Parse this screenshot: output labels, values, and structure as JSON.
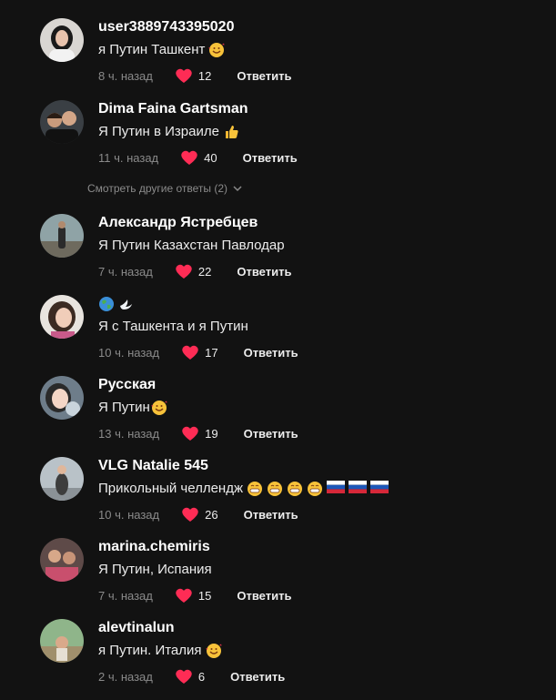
{
  "comments": [
    {
      "username": "user3889743395020",
      "text": "я Путин Ташкент",
      "emoji": [
        "smiling-hearts"
      ],
      "time": "8 ч. назад",
      "likes": "12",
      "reply": "Ответить"
    },
    {
      "username": "Dima Faina Gartsman",
      "text": "Я Путин в Израиле",
      "emoji": [
        "thumbs-up"
      ],
      "time": "11 ч. назад",
      "likes": "40",
      "reply": "Ответить"
    },
    {
      "username": "Александр Ястребцев",
      "text": "Я Путин Казахстан Павлодар",
      "emoji": [],
      "time": "7 ч. назад",
      "likes": "22",
      "reply": "Ответить"
    },
    {
      "username": "",
      "username_emoji": [
        "globe",
        "dove"
      ],
      "text": "Я с Ташкента и я Путин",
      "emoji": [],
      "time": "10 ч. назад",
      "likes": "17",
      "reply": "Ответить"
    },
    {
      "username": "Русская",
      "text": "Я Путин",
      "emoji": [
        "smiling-hearts"
      ],
      "time": "13 ч. назад",
      "likes": "19",
      "reply": "Ответить"
    },
    {
      "username": "VLG Natalie 545",
      "text": "Прикольный челлендж",
      "emoji": [
        "grin",
        "grin",
        "grin",
        "grin",
        "flag-ru",
        "flag-ru",
        "flag-ru"
      ],
      "time": "10 ч. назад",
      "likes": "26",
      "reply": "Ответить"
    },
    {
      "username": "marina.chemiris",
      "text": "Я Путин, Испания",
      "emoji": [],
      "time": "7 ч. назад",
      "likes": "15",
      "reply": "Ответить"
    },
    {
      "username": "alevtinalun",
      "text": "я Путин. Италия",
      "emoji": [
        "smiling-hearts"
      ],
      "time": "2 ч. назад",
      "likes": "6",
      "reply": "Ответить"
    }
  ],
  "more_replies": {
    "label": "Смотреть другие ответы (2)",
    "icon": "chevron-down-icon"
  },
  "colors": {
    "background": "#121212",
    "heart": "#fe2c55",
    "muted": "#8a8a8a",
    "text": "#ececec"
  }
}
